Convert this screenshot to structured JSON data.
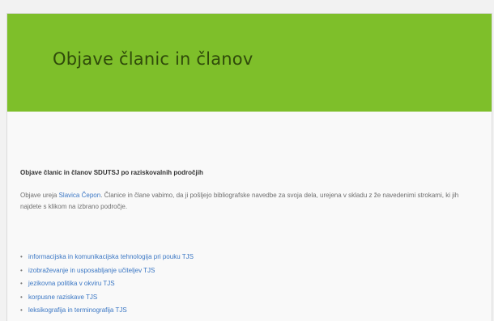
{
  "banner": {
    "title": "Objave članic in članov"
  },
  "main": {
    "heading": "Objave članic in članov SDUTSJ po raziskovalnih področjih",
    "intro": {
      "before_link": "Objave ureja ",
      "link": "Slavica Čepon",
      "after_link": ". Članice in člane vabimo, da ji pošljejo bibliografske navedbe za svoja dela, urejena v skladu z že navedenimi strokami, ki jih najdete s klikom na izbrano področje."
    },
    "links": [
      "informacijska in komunikacijska tehnologija pri pouku TJS",
      "izobraževanje in usposabljanje učiteljev TJS",
      "jezikovna politika v okviru TJS",
      "korpusne raziskave TJS",
      "leksikografija in terminografija TJS"
    ],
    "bullet": "•"
  },
  "colors": {
    "banner": "#7ebf2a",
    "banner_title": "#2f4a0a",
    "link": "#3b77c4"
  }
}
